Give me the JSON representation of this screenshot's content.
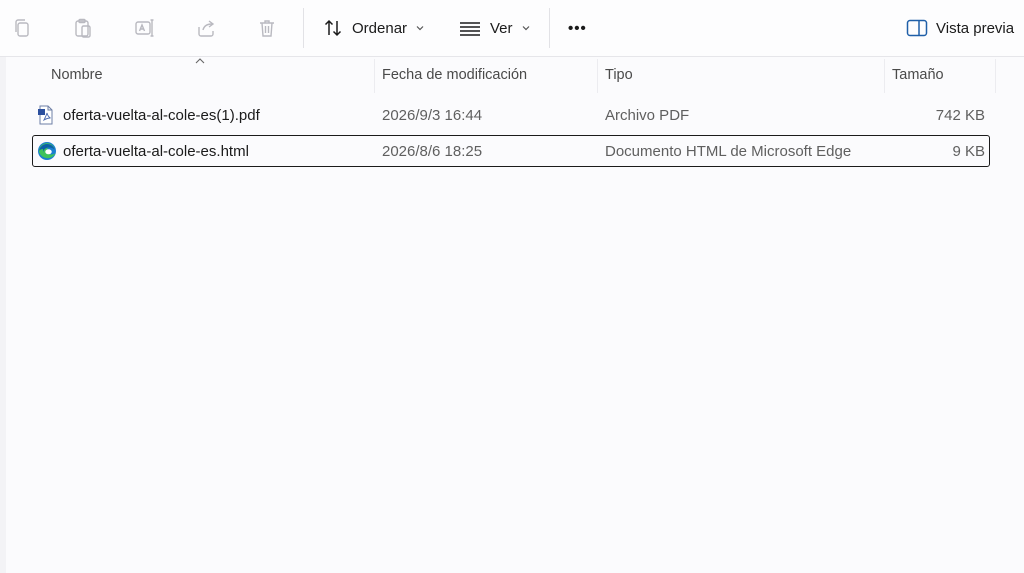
{
  "toolbar": {
    "icons": [
      {
        "name": "copy-icon"
      },
      {
        "name": "paste-icon"
      },
      {
        "name": "rename-icon"
      },
      {
        "name": "share-icon"
      },
      {
        "name": "delete-icon"
      }
    ],
    "sort_label": "Ordenar",
    "view_label": "Ver",
    "more_label": "•••",
    "preview_label": "Vista previa"
  },
  "columns": {
    "name": "Nombre",
    "modified": "Fecha de modificación",
    "type": "Tipo",
    "size": "Tamaño"
  },
  "files": [
    {
      "icon": "pdf-file-icon",
      "name": "oferta-vuelta-al-cole-es(1).pdf",
      "modified": "2026/9/3 16:44",
      "type": "Archivo PDF",
      "size": "742 KB",
      "selected": false
    },
    {
      "icon": "edge-html-file-icon",
      "name": "oferta-vuelta-al-cole-es.html",
      "modified": "2026/8/6 18:25",
      "type": "Documento HTML de Microsoft Edge",
      "size": "9 KB",
      "selected": true
    }
  ]
}
